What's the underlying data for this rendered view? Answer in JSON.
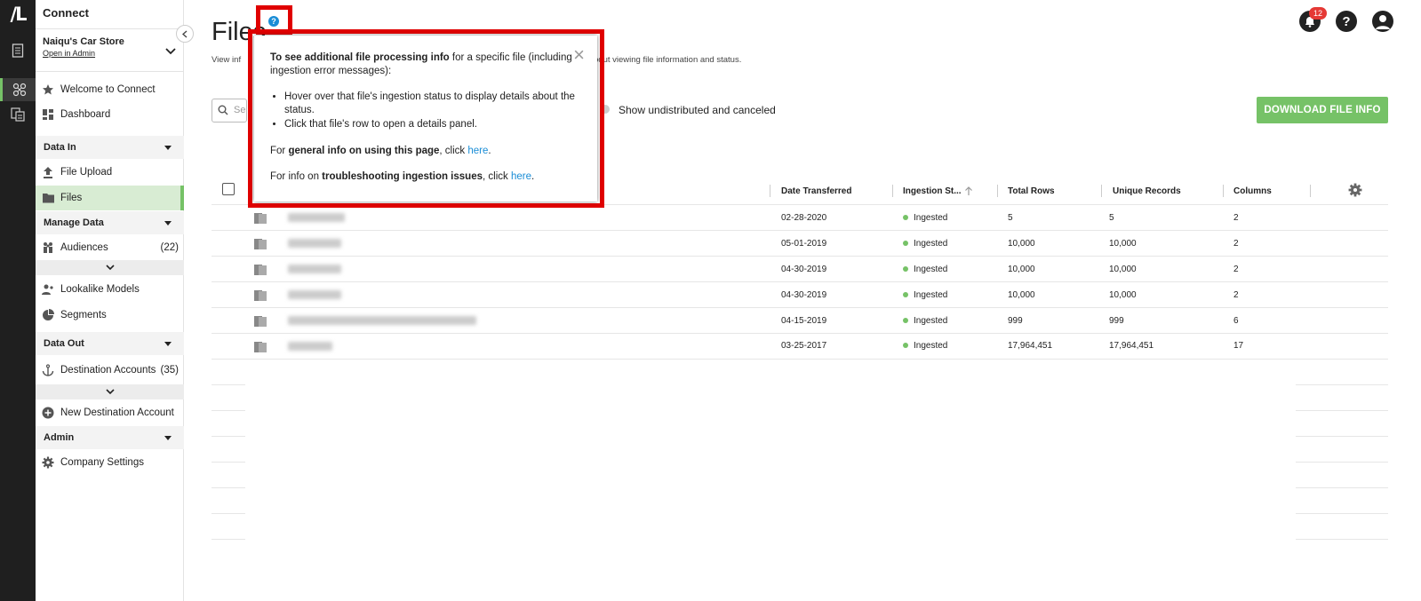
{
  "rail": {
    "logo": "/L"
  },
  "sidebar": {
    "title": "Connect",
    "company_name": "Naiqu's Car Store",
    "company_link": "Open in Admin",
    "items": [
      {
        "label": "Welcome to Connect"
      },
      {
        "label": "Dashboard"
      },
      {
        "label": "File Upload"
      },
      {
        "label": "Files"
      },
      {
        "label": "Audiences",
        "count": "(22)"
      },
      {
        "label": "Lookalike Models"
      },
      {
        "label": "Segments"
      },
      {
        "label": "Destination Accounts",
        "count": "(35)"
      },
      {
        "label": "New Destination Account"
      },
      {
        "label": "Company Settings"
      }
    ],
    "sections": [
      "Data In",
      "Manage Data",
      "Data Out",
      "Admin"
    ]
  },
  "header": {
    "title": "Files",
    "desc_left": "View inf",
    "desc_right": "bout viewing file information and status.",
    "notifications_count": "12",
    "help_icon_glyph": "?"
  },
  "toolbar": {
    "search_placeholder": "Se",
    "toggle_label": "Show undistributed and canceled",
    "download_label": "DOWNLOAD FILE INFO"
  },
  "table": {
    "columns": [
      "Date Transferred",
      "Ingestion St...",
      "Total Rows",
      "Unique Records",
      "Columns"
    ],
    "rows": [
      {
        "date": "02-28-2020",
        "status": "Ingested",
        "total": "5",
        "unique": "5",
        "cols": "2"
      },
      {
        "date": "05-01-2019",
        "status": "Ingested",
        "total": "10,000",
        "unique": "10,000",
        "cols": "2"
      },
      {
        "date": "04-30-2019",
        "status": "Ingested",
        "total": "10,000",
        "unique": "10,000",
        "cols": "2"
      },
      {
        "date": "04-30-2019",
        "status": "Ingested",
        "total": "10,000",
        "unique": "10,000",
        "cols": "2"
      },
      {
        "date": "04-15-2019",
        "status": "Ingested",
        "total": "999",
        "unique": "999",
        "cols": "6"
      },
      {
        "date": "03-25-2017",
        "status": "Ingested",
        "total": "17,964,451",
        "unique": "17,964,451",
        "cols": "17"
      }
    ]
  },
  "popup": {
    "p1_bold": "To see additional file processing info",
    "p1_rest": " for a specific file (including ingestion error messages):",
    "li1": "Hover over that file's ingestion status to display details about the status.",
    "li2": "Click that file's row to open a details panel.",
    "p2_pre": "For ",
    "p2_bold": "general info on using this page",
    "p2_mid": ", click ",
    "p2_link": "here",
    "p2_end": ".",
    "p3_pre": "For info on ",
    "p3_bold": "troubleshooting ingestion issues",
    "p3_mid": ", click ",
    "p3_link": "here",
    "p3_end": ".",
    "close_glyph": "×"
  }
}
